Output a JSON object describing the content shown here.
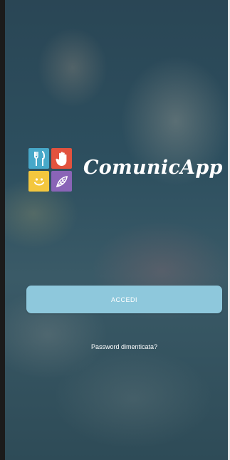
{
  "app": {
    "brand_name": "ComunicApp",
    "logo_icons": [
      "cutlery-icon",
      "hand-icon",
      "smiley-icon",
      "leaf-icon"
    ]
  },
  "login": {
    "login_label": "ACCEDI",
    "forgot_password_label": "Password dimenticata?"
  },
  "colors": {
    "button_bg": "#8ec8dc",
    "overlay": "#2d4f5f",
    "tile_blue": "#47a8c9",
    "tile_red": "#e2523e",
    "tile_yellow": "#f4c73e",
    "tile_purple": "#8a64b7"
  }
}
